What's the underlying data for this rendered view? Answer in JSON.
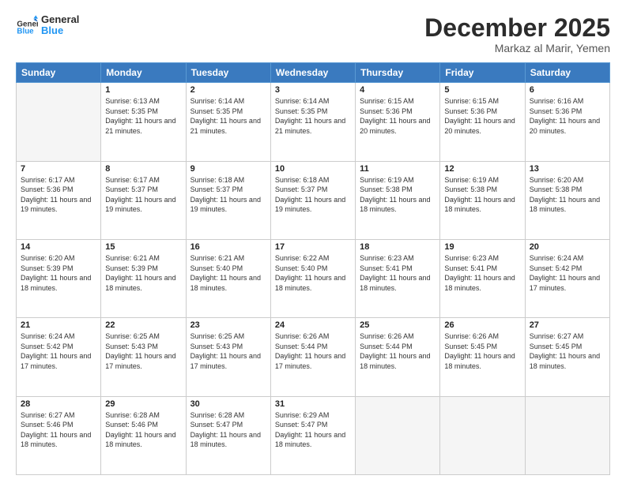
{
  "logo": {
    "line1": "General",
    "line2": "Blue"
  },
  "title": "December 2025",
  "location": "Markaz al Marir, Yemen",
  "weekdays": [
    "Sunday",
    "Monday",
    "Tuesday",
    "Wednesday",
    "Thursday",
    "Friday",
    "Saturday"
  ],
  "weeks": [
    [
      {
        "day": "",
        "sunrise": "",
        "sunset": "",
        "daylight": ""
      },
      {
        "day": "1",
        "sunrise": "6:13 AM",
        "sunset": "5:35 PM",
        "daylight": "11 hours and 21 minutes."
      },
      {
        "day": "2",
        "sunrise": "6:14 AM",
        "sunset": "5:35 PM",
        "daylight": "11 hours and 21 minutes."
      },
      {
        "day": "3",
        "sunrise": "6:14 AM",
        "sunset": "5:35 PM",
        "daylight": "11 hours and 21 minutes."
      },
      {
        "day": "4",
        "sunrise": "6:15 AM",
        "sunset": "5:36 PM",
        "daylight": "11 hours and 20 minutes."
      },
      {
        "day": "5",
        "sunrise": "6:15 AM",
        "sunset": "5:36 PM",
        "daylight": "11 hours and 20 minutes."
      },
      {
        "day": "6",
        "sunrise": "6:16 AM",
        "sunset": "5:36 PM",
        "daylight": "11 hours and 20 minutes."
      }
    ],
    [
      {
        "day": "7",
        "sunrise": "6:17 AM",
        "sunset": "5:36 PM",
        "daylight": "11 hours and 19 minutes."
      },
      {
        "day": "8",
        "sunrise": "6:17 AM",
        "sunset": "5:37 PM",
        "daylight": "11 hours and 19 minutes."
      },
      {
        "day": "9",
        "sunrise": "6:18 AM",
        "sunset": "5:37 PM",
        "daylight": "11 hours and 19 minutes."
      },
      {
        "day": "10",
        "sunrise": "6:18 AM",
        "sunset": "5:37 PM",
        "daylight": "11 hours and 19 minutes."
      },
      {
        "day": "11",
        "sunrise": "6:19 AM",
        "sunset": "5:38 PM",
        "daylight": "11 hours and 18 minutes."
      },
      {
        "day": "12",
        "sunrise": "6:19 AM",
        "sunset": "5:38 PM",
        "daylight": "11 hours and 18 minutes."
      },
      {
        "day": "13",
        "sunrise": "6:20 AM",
        "sunset": "5:38 PM",
        "daylight": "11 hours and 18 minutes."
      }
    ],
    [
      {
        "day": "14",
        "sunrise": "6:20 AM",
        "sunset": "5:39 PM",
        "daylight": "11 hours and 18 minutes."
      },
      {
        "day": "15",
        "sunrise": "6:21 AM",
        "sunset": "5:39 PM",
        "daylight": "11 hours and 18 minutes."
      },
      {
        "day": "16",
        "sunrise": "6:21 AM",
        "sunset": "5:40 PM",
        "daylight": "11 hours and 18 minutes."
      },
      {
        "day": "17",
        "sunrise": "6:22 AM",
        "sunset": "5:40 PM",
        "daylight": "11 hours and 18 minutes."
      },
      {
        "day": "18",
        "sunrise": "6:23 AM",
        "sunset": "5:41 PM",
        "daylight": "11 hours and 18 minutes."
      },
      {
        "day": "19",
        "sunrise": "6:23 AM",
        "sunset": "5:41 PM",
        "daylight": "11 hours and 18 minutes."
      },
      {
        "day": "20",
        "sunrise": "6:24 AM",
        "sunset": "5:42 PM",
        "daylight": "11 hours and 17 minutes."
      }
    ],
    [
      {
        "day": "21",
        "sunrise": "6:24 AM",
        "sunset": "5:42 PM",
        "daylight": "11 hours and 17 minutes."
      },
      {
        "day": "22",
        "sunrise": "6:25 AM",
        "sunset": "5:43 PM",
        "daylight": "11 hours and 17 minutes."
      },
      {
        "day": "23",
        "sunrise": "6:25 AM",
        "sunset": "5:43 PM",
        "daylight": "11 hours and 17 minutes."
      },
      {
        "day": "24",
        "sunrise": "6:26 AM",
        "sunset": "5:44 PM",
        "daylight": "11 hours and 17 minutes."
      },
      {
        "day": "25",
        "sunrise": "6:26 AM",
        "sunset": "5:44 PM",
        "daylight": "11 hours and 18 minutes."
      },
      {
        "day": "26",
        "sunrise": "6:26 AM",
        "sunset": "5:45 PM",
        "daylight": "11 hours and 18 minutes."
      },
      {
        "day": "27",
        "sunrise": "6:27 AM",
        "sunset": "5:45 PM",
        "daylight": "11 hours and 18 minutes."
      }
    ],
    [
      {
        "day": "28",
        "sunrise": "6:27 AM",
        "sunset": "5:46 PM",
        "daylight": "11 hours and 18 minutes."
      },
      {
        "day": "29",
        "sunrise": "6:28 AM",
        "sunset": "5:46 PM",
        "daylight": "11 hours and 18 minutes."
      },
      {
        "day": "30",
        "sunrise": "6:28 AM",
        "sunset": "5:47 PM",
        "daylight": "11 hours and 18 minutes."
      },
      {
        "day": "31",
        "sunrise": "6:29 AM",
        "sunset": "5:47 PM",
        "daylight": "11 hours and 18 minutes."
      },
      {
        "day": "",
        "sunrise": "",
        "sunset": "",
        "daylight": ""
      },
      {
        "day": "",
        "sunrise": "",
        "sunset": "",
        "daylight": ""
      },
      {
        "day": "",
        "sunrise": "",
        "sunset": "",
        "daylight": ""
      }
    ]
  ]
}
